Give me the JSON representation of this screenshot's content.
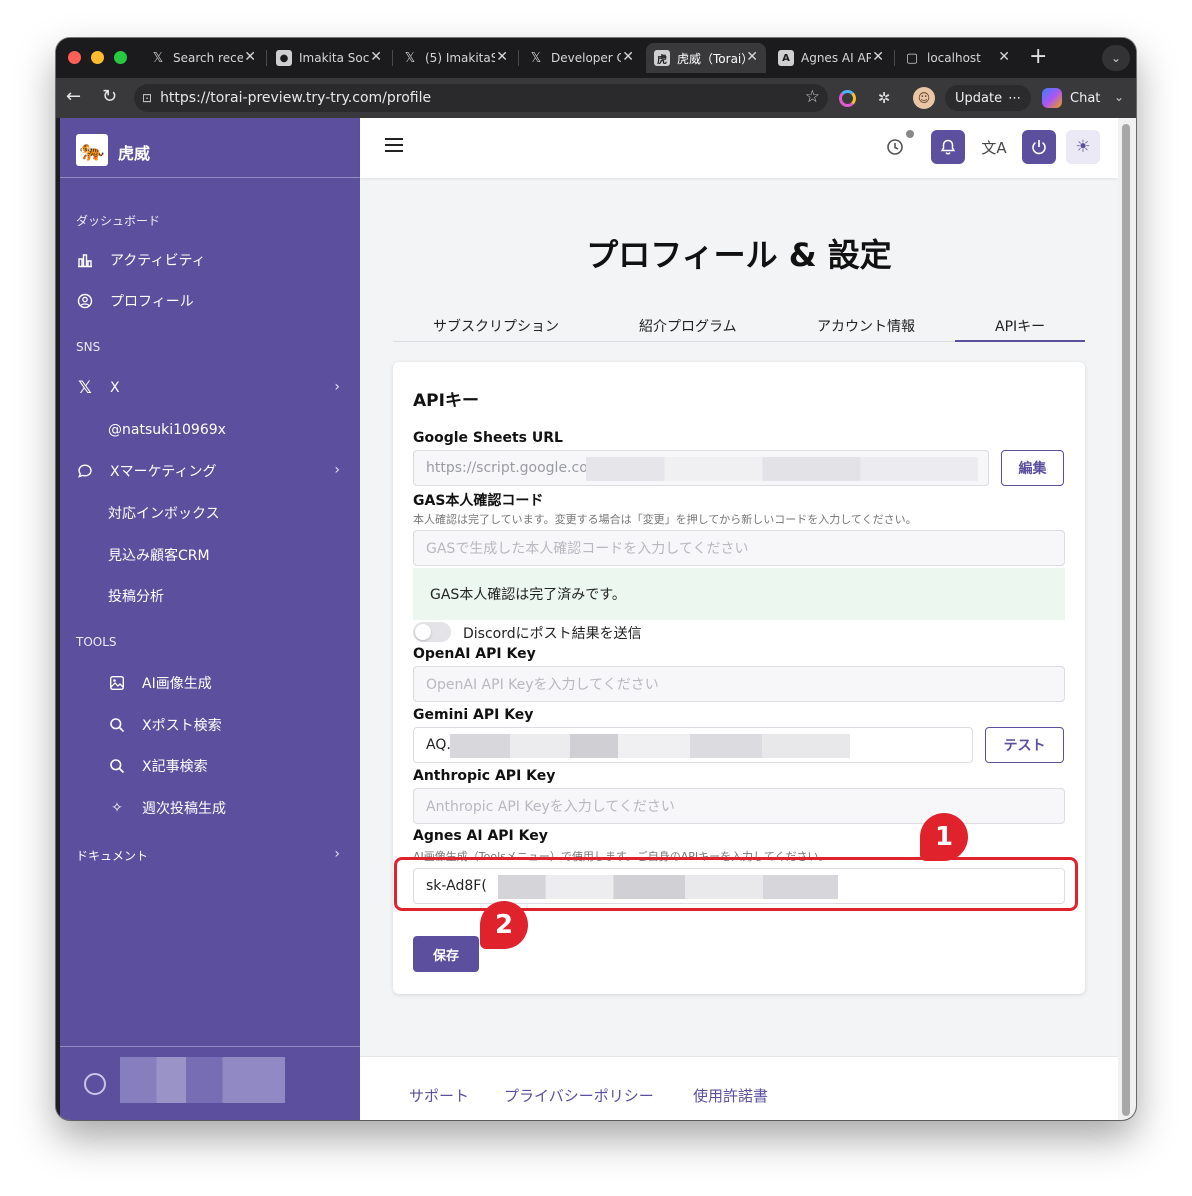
{
  "browser": {
    "tabs": [
      {
        "title": "Search rece",
        "icon": "x-logo-icon"
      },
      {
        "title": "Imakita Soci",
        "icon": "app-icon"
      },
      {
        "title": "(5) ImakitaS",
        "icon": "x-logo-icon"
      },
      {
        "title": "Developer C",
        "icon": "x-logo-icon"
      },
      {
        "title": "虎威（Torai）",
        "icon": "torai-icon",
        "active": true
      },
      {
        "title": "Agnes AI AP",
        "icon": "agnes-icon"
      },
      {
        "title": "localhost",
        "icon": "page-icon"
      }
    ],
    "url": "https://torai-preview.try-try.com/profile",
    "update_label": "Update",
    "chat_label": "Chat"
  },
  "sidebar": {
    "brand": "虎威",
    "sections": {
      "dashboard": "ダッシュボード",
      "sns": "SNS",
      "tools": "TOOLS",
      "docs": "ドキュメント"
    },
    "dashboard_items": [
      {
        "label": "アクティビティ",
        "icon": "bar-chart-icon"
      },
      {
        "label": "プロフィール",
        "icon": "user-circle-icon"
      }
    ],
    "x_label": "X",
    "x_account": "@natsuki10969x",
    "x_marketing": "Xマーケティング",
    "marketing_subitems": [
      "対応インボックス",
      "見込み顧客CRM",
      "投稿分析"
    ],
    "tools_items": [
      {
        "label": "AI画像生成",
        "icon": "image-icon"
      },
      {
        "label": "Xポスト検索",
        "icon": "search-icon"
      },
      {
        "label": "X記事検索",
        "icon": "search-icon"
      },
      {
        "label": "週次投稿生成",
        "icon": "sparkle-icon"
      }
    ]
  },
  "main": {
    "title": "プロフィール & 設定",
    "tabs": [
      "サブスクリプション",
      "紹介プログラム",
      "アカウント情報",
      "APIキー"
    ],
    "active_tab": "APIキー",
    "card": {
      "title": "APIキー",
      "sheets_label": "Google Sheets URL",
      "sheets_value": "https://script.google.cor",
      "edit_button": "編集",
      "gas_label": "GAS本人確認コード",
      "gas_hint": "本人確認は完了しています。変更する場合は「変更」を押してから新しいコードを入力してください。",
      "gas_placeholder": "GASで生成した本人確認コードを入力してください",
      "gas_success": "GAS本人確認は完了済みです。",
      "discord_toggle": "Discordにポスト結果を送信",
      "openai_label": "OpenAI API Key",
      "openai_placeholder": "OpenAI API Keyを入力してください",
      "gemini_label": "Gemini API Key",
      "gemini_value": "AQ.",
      "test_button": "テスト",
      "anthropic_label": "Anthropic API Key",
      "anthropic_placeholder": "Anthropic API Keyを入力してください",
      "agnes_label": "Agnes AI API Key",
      "agnes_hint": "AI画像生成（Toolsメニュー）で使用します。ご自身のAPIキーを入力してください。",
      "agnes_value": "sk-Ad8F(",
      "save_button": "保存"
    },
    "annotations": [
      "1",
      "2"
    ]
  },
  "footer": {
    "links": [
      "サポート",
      "プライバシーポリシー",
      "使用許諾書"
    ]
  },
  "colors": {
    "accent": "#5b4f9e",
    "highlight": "#e0222d",
    "success_bg": "#ecf8ef"
  }
}
